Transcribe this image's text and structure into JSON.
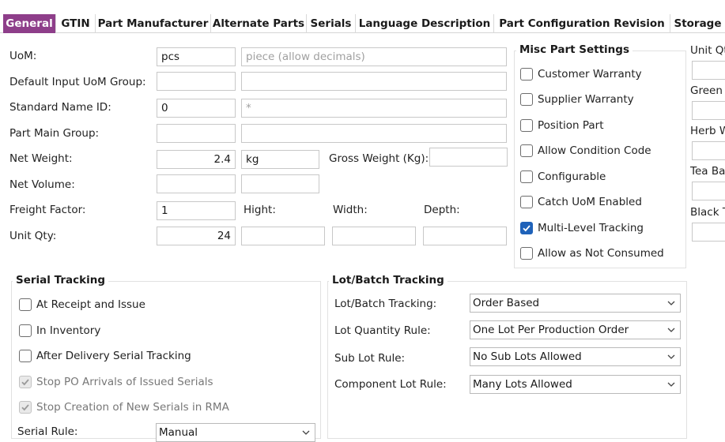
{
  "tabs": [
    "General",
    "GTIN",
    "Part Manufacturer",
    "Alternate Parts",
    "Serials",
    "Language Description",
    "Part Configuration Revision",
    "Storage"
  ],
  "form": {
    "uom_label": "UoM:",
    "uom_value": "pcs",
    "uom_desc_placeholder": "piece (allow decimals)",
    "default_uom_group_label": "Default Input UoM Group:",
    "standard_name_label": "Standard Name ID:",
    "standard_name_value": "0",
    "standard_name_desc": "*",
    "part_main_group_label": "Part Main Group:",
    "net_weight_label": "Net Weight:",
    "net_weight_value": "2.4",
    "net_weight_unit": "kg",
    "gross_weight_label": "Gross Weight (Kg):",
    "net_volume_label": "Net Volume:",
    "freight_factor_label": "Freight Factor:",
    "freight_factor_value": "1",
    "height_label": "Hight:",
    "width_label": "Width:",
    "depth_label": "Depth:",
    "unit_qty_label": "Unit Qty:",
    "unit_qty_value": "24"
  },
  "misc": {
    "title": "Misc Part Settings",
    "items": [
      {
        "label": "Customer Warranty",
        "checked": false
      },
      {
        "label": "Supplier Warranty",
        "checked": false
      },
      {
        "label": "Position Part",
        "checked": false
      },
      {
        "label": "Allow Condition Code",
        "checked": false
      },
      {
        "label": "Configurable",
        "checked": false
      },
      {
        "label": "Catch UoM Enabled",
        "checked": false
      },
      {
        "label": "Multi-Level Tracking",
        "checked": true
      },
      {
        "label": "Allow as Not Consumed",
        "checked": false
      }
    ]
  },
  "right_col": {
    "unit_qty": "Unit Qt",
    "green": "Green T",
    "herb": "Herb W",
    "tea": "Tea Bag",
    "black": "Black Te"
  },
  "serial": {
    "title": "Serial Tracking",
    "items": [
      {
        "label": "At Receipt and Issue",
        "checked": false,
        "disabled": false
      },
      {
        "label": "In Inventory",
        "checked": false,
        "disabled": false
      },
      {
        "label": "After Delivery Serial Tracking",
        "checked": false,
        "disabled": false
      },
      {
        "label": "Stop PO Arrivals of Issued Serials",
        "checked": true,
        "disabled": true
      },
      {
        "label": "Stop Creation of New Serials in RMA",
        "checked": true,
        "disabled": true
      }
    ],
    "rule_label": "Serial Rule:",
    "rule_value": "Manual"
  },
  "lot": {
    "title": "Lot/Batch Tracking",
    "rows": [
      {
        "label": "Lot/Batch Tracking:",
        "value": "Order Based"
      },
      {
        "label": "Lot Quantity Rule:",
        "value": "One Lot Per Production Order"
      },
      {
        "label": "Sub Lot Rule:",
        "value": "No Sub Lots Allowed"
      },
      {
        "label": "Component Lot Rule:",
        "value": "Many Lots Allowed"
      }
    ]
  }
}
